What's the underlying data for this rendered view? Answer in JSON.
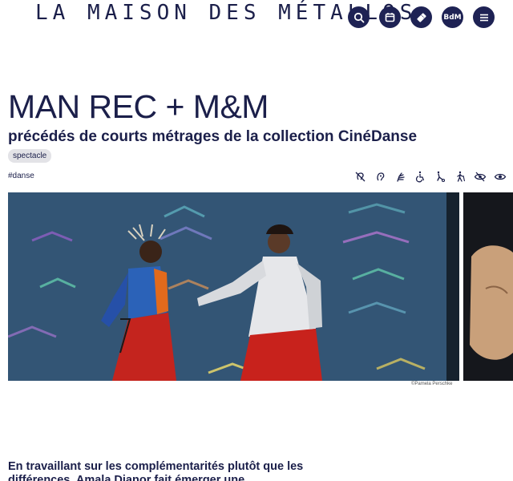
{
  "header": {
    "brand": "LA MAISON DES MÉTALLOS",
    "icons": [
      {
        "name": "search-icon"
      },
      {
        "name": "calendar-icon"
      },
      {
        "name": "ticket-icon"
      },
      {
        "name": "bdm-icon",
        "label": "BdM"
      },
      {
        "name": "menu-icon"
      }
    ]
  },
  "event": {
    "title": "MAN REC + M&M",
    "subtitle": "précédés de courts métrages de la collection CinéDanse",
    "category": "spectacle",
    "tag": "#danse"
  },
  "accessibility_icons": [
    "hearing-loop-icon",
    "deaf-icon",
    "sign-language-icon",
    "wheelchair-icon",
    "reduced-mobility-icon",
    "walking-icon",
    "visually-impaired-icon",
    "eye-icon"
  ],
  "gallery": {
    "credit": "©Pamela Perschke"
  },
  "intro": {
    "text": "En travaillant sur les complémentarités plutôt que les différences, Amala Dianor fait émerger une"
  },
  "colors": {
    "brand_navy": "#1b1f4a",
    "icon_bg": "#1e2254",
    "badge_bg": "#e3e3e7"
  }
}
